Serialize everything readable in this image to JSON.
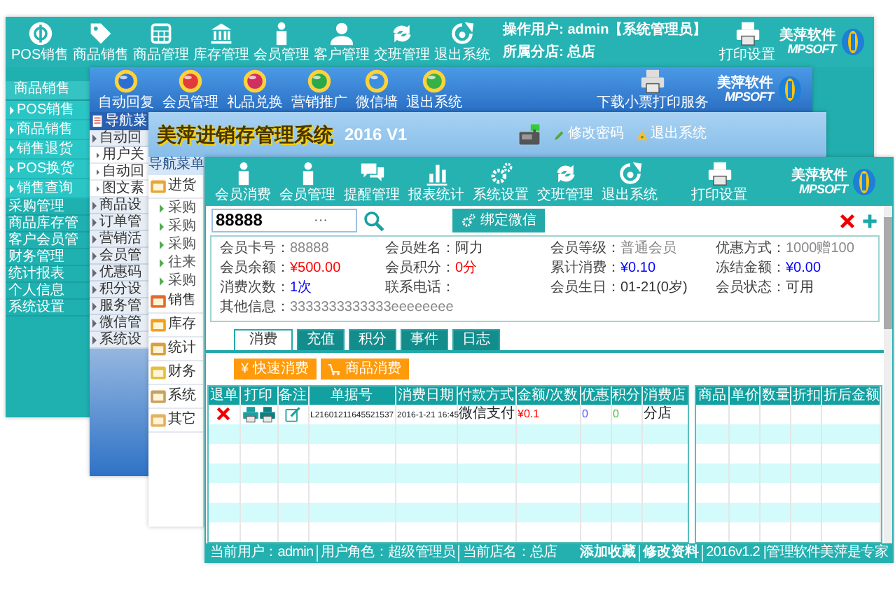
{
  "back_window": {
    "toolbar": [
      "POS销售",
      "商品销售",
      "商品管理",
      "库存管理",
      "会员管理",
      "客户管理",
      "交班管理",
      "退出系统"
    ],
    "operator": "操作用户: admin【系统管理员】",
    "branch": "所属分店: 总店",
    "print": "打印设置",
    "logo": {
      "name": "美萍软件",
      "latin": "MPSOFT"
    },
    "sidebar": {
      "section": "商品销售",
      "items": [
        "POS销售",
        "商品销售",
        "销售退货",
        "POS换货",
        "销售查询"
      ],
      "groups": [
        "采购管理",
        "商品库存管",
        "客户会员管",
        "财务管理",
        "统计报表",
        "个人信息",
        "系统设置"
      ]
    }
  },
  "wechat_window": {
    "toolbar": [
      "自动回复",
      "会员管理",
      "礼品兑换",
      "营销推广",
      "微信墙",
      "退出系统"
    ],
    "download": "下载小票打印服务",
    "logo": {
      "name": "美萍软件",
      "latin": "MPSOFT"
    },
    "nav_title": "导航菜",
    "tree": [
      {
        "label": "自动回",
        "children": [
          {
            "label": "用户关"
          },
          {
            "label": "自动回"
          },
          {
            "label": "图文素"
          }
        ]
      },
      {
        "label": "商品设"
      },
      {
        "label": "订单管"
      },
      {
        "label": "营销活"
      },
      {
        "label": "会员管"
      },
      {
        "label": "优惠码"
      },
      {
        "label": "积分设"
      },
      {
        "label": "服务管"
      },
      {
        "label": "微信管"
      },
      {
        "label": "系统设"
      }
    ]
  },
  "erp_window": {
    "title": "美萍进销存管理系统",
    "version": "2016 V1",
    "links": [
      "修改密码",
      "退出系统"
    ],
    "nav_title": "导航菜单",
    "menu": [
      {
        "label": "进货",
        "children": [
          {
            "label": "采购"
          },
          {
            "label": "采购"
          },
          {
            "label": "采购"
          },
          {
            "label": "往来"
          },
          {
            "label": "采购"
          }
        ]
      },
      {
        "label": "销售"
      },
      {
        "label": "库存"
      },
      {
        "label": "统计"
      },
      {
        "label": "财务"
      },
      {
        "label": "系统"
      },
      {
        "label": "其它"
      }
    ]
  },
  "member_window": {
    "toolbar": [
      "会员消费",
      "会员管理",
      "提醒管理",
      "报表统计",
      "系统设置",
      "交班管理",
      "退出系统"
    ],
    "print": "打印设置",
    "logo": {
      "name": "美萍软件",
      "latin": "MPSOFT"
    },
    "search": {
      "value": "88888",
      "more": "···"
    },
    "bind_button": "绑定微信",
    "info": [
      {
        "label": "会员卡号：",
        "value": "88888",
        "color": "#888888"
      },
      {
        "label": "会员姓名：",
        "value": "阿力",
        "color": "#333333"
      },
      {
        "label": "会员等级：",
        "value": "普通会员",
        "color": "#888888"
      },
      {
        "label": "优惠方式：",
        "value": "1000赠100",
        "color": "#888888"
      },
      {
        "label": "会员余额：",
        "value": "¥500.00",
        "color": "#ff0000"
      },
      {
        "label": "会员积分：",
        "value": "0分",
        "color": "#ff0000"
      },
      {
        "label": "累计消费：",
        "value": "¥0.10",
        "color": "#0000ff"
      },
      {
        "label": "冻结金额：",
        "value": "¥0.00",
        "color": "#0000ff"
      },
      {
        "label": "消费次数：",
        "value": "1次",
        "color": "#0000ff"
      },
      {
        "label": "联系电话："
      },
      {
        "label": "会员生日：",
        "value": "01-21(0岁)",
        "color": "#333333"
      },
      {
        "label": "会员状态：",
        "value": "可用",
        "color": "#333333"
      },
      {
        "label": "其他信息：",
        "value": "3333333333333eeeeeeee",
        "color": "#888888"
      }
    ],
    "tabs": [
      {
        "label": "消费",
        "selected": true
      },
      {
        "label": "充值",
        "selected": false
      },
      {
        "label": "积分",
        "selected": false
      },
      {
        "label": "事件",
        "selected": false
      },
      {
        "label": "日志",
        "selected": false
      }
    ],
    "actions": [
      {
        "symbol": "¥",
        "label": "快速消费"
      },
      {
        "label": "商品消费"
      }
    ],
    "orders": {
      "columns": [
        "退单",
        "打印",
        "备注",
        "单据号",
        "消费日期",
        "付款方式",
        "金额/次数",
        "优惠",
        "积分",
        "消费店"
      ],
      "rows": [
        {
          "number": "L21601211645521537",
          "date": "2016-1-21 16:45",
          "payment": "微信支付",
          "amount": "¥0.1",
          "discount": "0",
          "points": "0",
          "store": "分店"
        }
      ]
    },
    "items_table": {
      "columns": [
        "商品",
        "单价",
        "数量",
        "折扣",
        "折后金额"
      ]
    },
    "status_bar": {
      "left": [
        "当前用户：admin",
        "用户角色：超级管理员",
        "当前店名：总店"
      ],
      "links": [
        "添加收藏",
        "修改资料"
      ],
      "version": "2016v1.2 |管理软件美萍是专家"
    }
  }
}
